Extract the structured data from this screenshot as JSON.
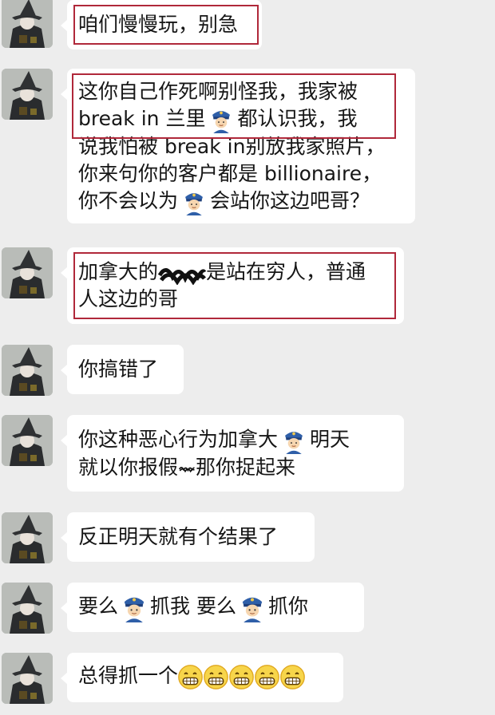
{
  "chat": {
    "messages": [
      {
        "lines": [
          "咱们慢慢玩，别急"
        ]
      },
      {
        "lines": [
          "这你自己作死啊别怪我，我家被",
          "break in 兰里",
          "都认识我，我",
          "说我怕被 break in别放我家照片，",
          "你来句你的客户都是 billionaire，",
          "你不会以为",
          "会站你这边吧哥？"
        ]
      },
      {
        "lines": [
          "加拿大的",
          "是站在穷人，普通",
          "人这边的哥"
        ]
      },
      {
        "lines": [
          "你搞错了"
        ]
      },
      {
        "lines": [
          "你这种恶心行为加拿大",
          "明天",
          "就以你报假",
          "那你捉起来"
        ]
      },
      {
        "lines": [
          "反正明天就有个结果了"
        ]
      },
      {
        "lines": [
          "要么",
          "抓我 要么",
          "抓你"
        ]
      },
      {
        "lines": [
          "总得抓一个"
        ]
      }
    ]
  },
  "icons": {
    "avatar": "witch-avatar-icon",
    "police": "police-officer-emoji-icon",
    "grin": "grinning-face-emoji-icon",
    "scribble": "scribble-redaction-icon"
  },
  "colors": {
    "background": "#ededed",
    "bubble": "#ffffff",
    "highlight": "#b0283a"
  }
}
